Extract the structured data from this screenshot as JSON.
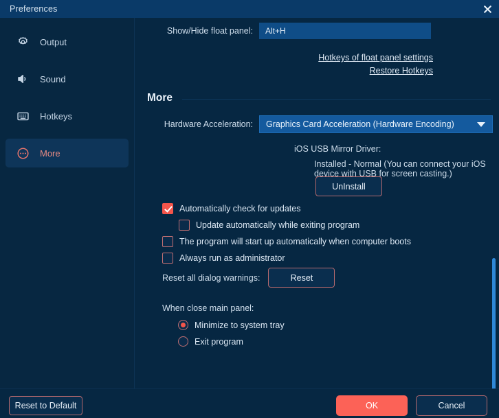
{
  "window": {
    "title": "Preferences",
    "close_icon": "close-icon"
  },
  "sidebar": {
    "items": [
      {
        "label": "Output",
        "icon": "gear-icon",
        "active": false
      },
      {
        "label": "Sound",
        "icon": "speaker-icon",
        "active": false
      },
      {
        "label": "Hotkeys",
        "icon": "keyboard-icon",
        "active": false
      },
      {
        "label": "More",
        "icon": "more-circle-icon",
        "active": true
      }
    ]
  },
  "hotkeys": {
    "float_panel_label": "Show/Hide float panel:",
    "float_panel_value": "Alt+H",
    "float_panel_placeholder": "Alt+H",
    "link_settings": "Hotkeys of float panel settings",
    "link_restore": "Restore Hotkeys"
  },
  "more": {
    "section_title": "More",
    "hardware_accel_label": "Hardware Acceleration:",
    "hardware_accel_value": "Graphics Card Acceleration (Hardware Encoding)",
    "hardware_accel_options": [
      "Graphics Card Acceleration (Hardware Encoding)"
    ],
    "driver_title": "iOS USB Mirror Driver:",
    "driver_status": "Installed - Normal (You can connect your iOS device with USB for screen casting.)",
    "uninstall_label": "UnInstall",
    "checkboxes": [
      {
        "label": "Automatically check for updates",
        "checked": true
      },
      {
        "label": "Update automatically while exiting program",
        "checked": false
      },
      {
        "label": "The program will start up automatically when computer boots",
        "checked": false
      },
      {
        "label": "Always run as administrator",
        "checked": false
      }
    ],
    "reset_warnings_label": "Reset all dialog warnings:",
    "reset_button_label": "Reset",
    "close_panel_label": "When close main panel:",
    "radios": [
      {
        "label": "Minimize to system tray",
        "selected": true
      },
      {
        "label": "Exit program",
        "selected": false
      }
    ]
  },
  "footer": {
    "reset_default_label": "Reset to Default",
    "ok_label": "OK",
    "cancel_label": "Cancel"
  },
  "colors": {
    "accent": "#fc6257",
    "titlebar": "#0a3a68",
    "background": "#062742",
    "select_blue": "#145a9e",
    "scrollbar": "#2f88d8"
  }
}
